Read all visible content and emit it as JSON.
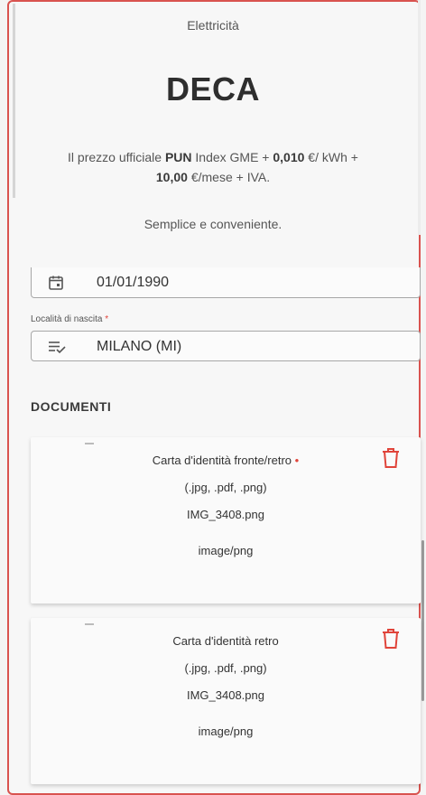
{
  "header": {
    "category": "Elettricità",
    "product_title": "DECA",
    "price": {
      "prefix": "Il prezzo ufficiale ",
      "index_name": "PUN",
      "index_desc": " Index GME + ",
      "spread": "0,010",
      "spread_unit": " €/ kWh + ",
      "monthly_fee": "10,00",
      "monthly_unit": " €/mese + IVA."
    },
    "tagline": "Semplice e conveniente."
  },
  "form": {
    "birth_date": "01/01/1990",
    "birth_place_label": "Località di nascita",
    "birth_place_required": "*",
    "birth_place_value": "MILANO (MI)"
  },
  "documents": {
    "section_title": "DOCUMENTI",
    "required_marker": "•",
    "cards": [
      {
        "title": "Carta d'identità fronte/retro",
        "required": true,
        "formats": "(.jpg, .pdf, .png)",
        "file_name": "IMG_3408.png",
        "mime_type": "image/png"
      },
      {
        "title": "Carta d'identità retro",
        "required": false,
        "formats": "(.jpg, .pdf, .png)",
        "file_name": "IMG_3408.png",
        "mime_type": "image/png"
      }
    ]
  },
  "colors": {
    "accent_red": "#e0443a",
    "frame_border": "#d9534f",
    "text": "#333333"
  },
  "icons": {
    "date": "calendar-icon",
    "place": "list-check-icon",
    "delete": "trash-icon"
  }
}
